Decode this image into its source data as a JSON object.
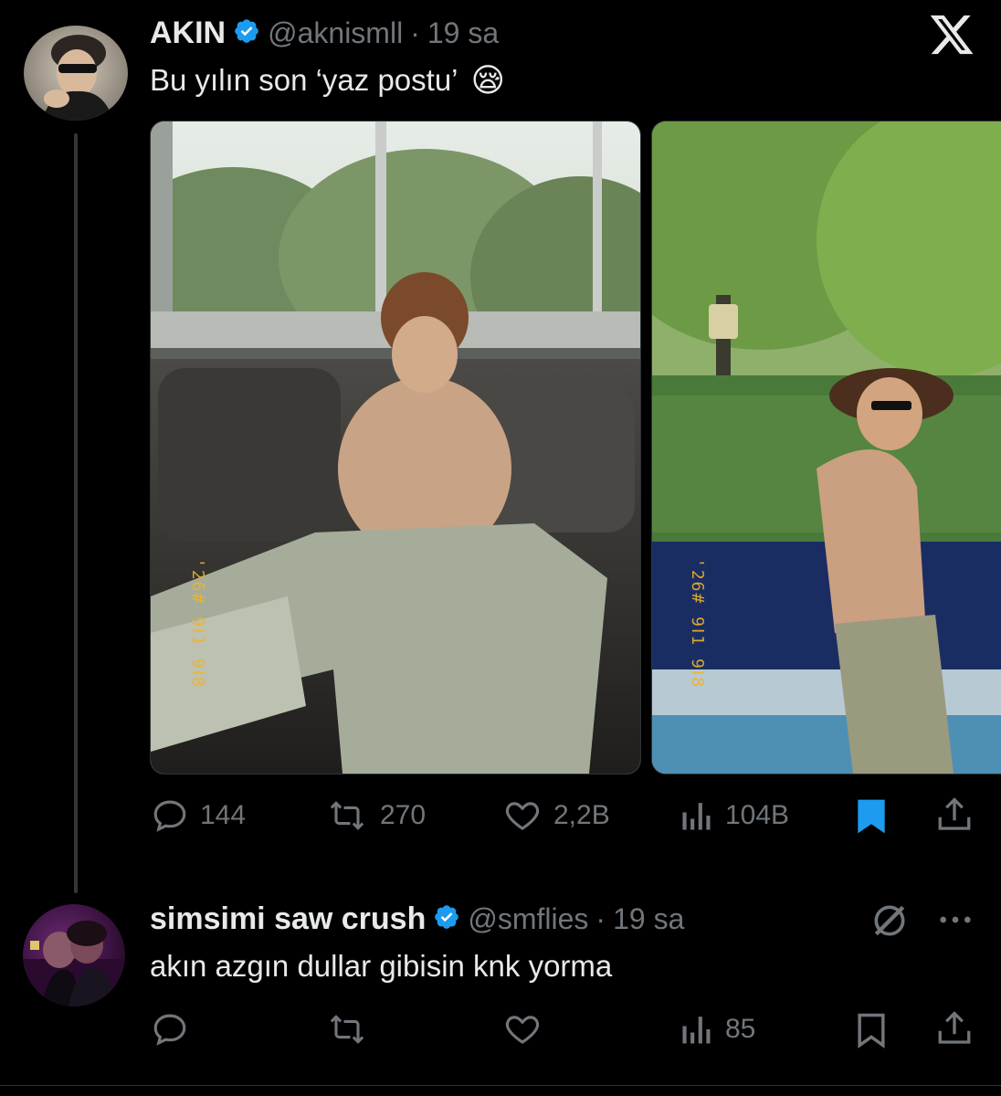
{
  "app": {
    "logo": "x-logo-icon"
  },
  "tweet": {
    "author_name": "AKIN",
    "handle": "@aknismll",
    "separator": "·",
    "time": "19 sa",
    "text": "Bu yılın son ‘yaz postu’",
    "emoji": "😪",
    "media": [
      {
        "stamp": "'26# 9Ⅰ1 9Ⅰ8"
      },
      {
        "stamp": "'26# 9Ⅰ1 9Ⅰ8"
      }
    ],
    "actions": {
      "replies": "144",
      "reposts": "270",
      "likes": "2,2B",
      "views": "104B"
    },
    "bookmarked": true
  },
  "reply": {
    "author_name": "simsimi saw crush",
    "handle": "@smflies",
    "separator": "·",
    "time": "19 sa",
    "text": "akın azgın dullar gibisin knk yorma",
    "actions": {
      "replies": "",
      "reposts": "",
      "likes": "",
      "views": "85"
    }
  },
  "colors": {
    "background": "#000000",
    "text": "#e7e9ea",
    "secondary": "#71767b",
    "verified": "#1d9bf0",
    "bookmark_active": "#1d9bf0"
  }
}
